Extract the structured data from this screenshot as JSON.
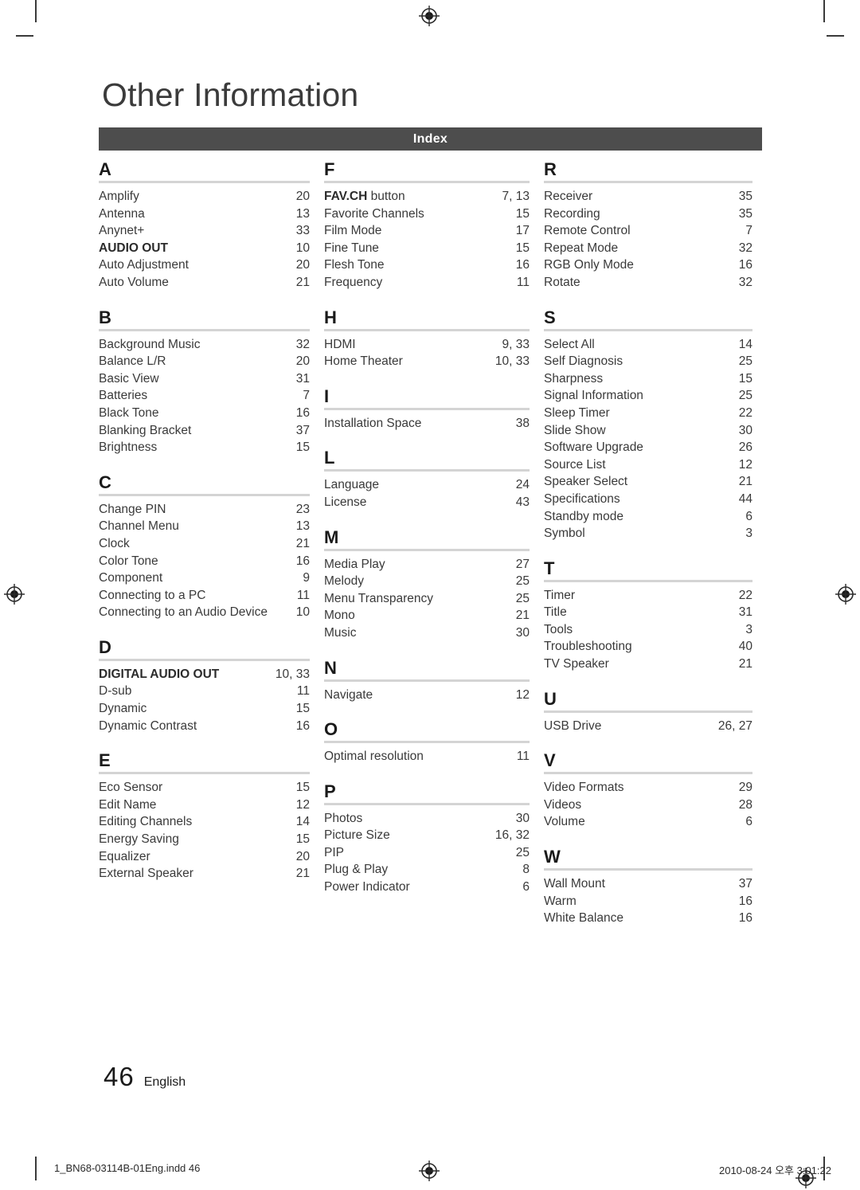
{
  "page": {
    "chapter_title": "Other Information",
    "index_bar_label": "Index",
    "folio_number": "46",
    "folio_language": "English",
    "accent_bar_color": "#4d4d4d",
    "rule_color": "#d4d4d4"
  },
  "print_footer": {
    "file_name": "1_BN68-03114B-01Eng.indd   46",
    "timestamp": "2010-08-24   오후 3:01:22"
  },
  "columns": [
    {
      "groups": [
        {
          "letter": "A",
          "entries": [
            {
              "term": "Amplify",
              "page": "20"
            },
            {
              "term": "Antenna",
              "page": "13"
            },
            {
              "term": "Anynet+",
              "page": "33"
            },
            {
              "term": "AUDIO OUT",
              "page": "10",
              "bold": true
            },
            {
              "term": "Auto Adjustment",
              "page": "20"
            },
            {
              "term": "Auto Volume",
              "page": "21"
            }
          ]
        },
        {
          "letter": "B",
          "entries": [
            {
              "term": "Background Music",
              "page": "32"
            },
            {
              "term": "Balance L/R",
              "page": "20"
            },
            {
              "term": "Basic View",
              "page": "31"
            },
            {
              "term": "Batteries",
              "page": "7"
            },
            {
              "term": "Black Tone",
              "page": "16"
            },
            {
              "term": "Blanking Bracket",
              "page": "37"
            },
            {
              "term": "Brightness",
              "page": "15"
            }
          ]
        },
        {
          "letter": "C",
          "entries": [
            {
              "term": "Change PIN",
              "page": "23"
            },
            {
              "term": "Channel Menu",
              "page": "13"
            },
            {
              "term": "Clock",
              "page": "21"
            },
            {
              "term": "Color Tone",
              "page": "16"
            },
            {
              "term": "Component",
              "page": "9"
            },
            {
              "term": "Connecting to a PC",
              "page": "11"
            },
            {
              "term": "Connecting to an Audio Device",
              "page": "10"
            }
          ]
        },
        {
          "letter": "D",
          "entries": [
            {
              "term": "DIGITAL AUDIO OUT",
              "page": "10, 33",
              "bold": true
            },
            {
              "term": "D-sub",
              "page": "11"
            },
            {
              "term": "Dynamic",
              "page": "15"
            },
            {
              "term": "Dynamic Contrast",
              "page": "16"
            }
          ]
        },
        {
          "letter": "E",
          "entries": [
            {
              "term": "Eco Sensor",
              "page": "15"
            },
            {
              "term": "Edit Name",
              "page": "12"
            },
            {
              "term": "Editing Channels",
              "page": "14"
            },
            {
              "term": "Energy Saving",
              "page": "15"
            },
            {
              "term": "Equalizer",
              "page": "20"
            },
            {
              "term": "External Speaker",
              "page": "21"
            }
          ]
        }
      ]
    },
    {
      "groups": [
        {
          "letter": "F",
          "entries": [
            {
              "term": "FAV.CH button",
              "page": "7, 13",
              "strong_prefix": "FAV.CH",
              "rest": " button"
            },
            {
              "term": "Favorite Channels",
              "page": "15"
            },
            {
              "term": "Film Mode",
              "page": "17"
            },
            {
              "term": "Fine Tune",
              "page": "15"
            },
            {
              "term": "Flesh Tone",
              "page": "16"
            },
            {
              "term": "Frequency",
              "page": "11"
            }
          ]
        },
        {
          "letter": "H",
          "entries": [
            {
              "term": "HDMI",
              "page": "9, 33"
            },
            {
              "term": "Home Theater",
              "page": "10, 33"
            }
          ]
        },
        {
          "letter": "I",
          "entries": [
            {
              "term": "Installation Space",
              "page": "38"
            }
          ]
        },
        {
          "letter": "L",
          "entries": [
            {
              "term": "Language",
              "page": "24"
            },
            {
              "term": "License",
              "page": "43"
            }
          ]
        },
        {
          "letter": "M",
          "entries": [
            {
              "term": "Media Play",
              "page": "27"
            },
            {
              "term": "Melody",
              "page": "25"
            },
            {
              "term": "Menu Transparency",
              "page": "25"
            },
            {
              "term": "Mono",
              "page": "21"
            },
            {
              "term": "Music",
              "page": "30"
            }
          ]
        },
        {
          "letter": "N",
          "entries": [
            {
              "term": "Navigate",
              "page": "12"
            }
          ]
        },
        {
          "letter": "O",
          "entries": [
            {
              "term": "Optimal resolution",
              "page": "11"
            }
          ]
        },
        {
          "letter": "P",
          "entries": [
            {
              "term": "Photos",
              "page": "30"
            },
            {
              "term": "Picture Size",
              "page": "16, 32"
            },
            {
              "term": "PIP",
              "page": "25"
            },
            {
              "term": "Plug & Play",
              "page": "8"
            },
            {
              "term": "Power Indicator",
              "page": "6"
            }
          ]
        }
      ]
    },
    {
      "groups": [
        {
          "letter": "R",
          "entries": [
            {
              "term": "Receiver",
              "page": "35"
            },
            {
              "term": "Recording",
              "page": "35"
            },
            {
              "term": "Remote Control",
              "page": "7"
            },
            {
              "term": "Repeat Mode",
              "page": "32"
            },
            {
              "term": "RGB Only Mode",
              "page": "16"
            },
            {
              "term": "Rotate",
              "page": "32"
            }
          ]
        },
        {
          "letter": "S",
          "entries": [
            {
              "term": "Select All",
              "page": "14"
            },
            {
              "term": "Self Diagnosis",
              "page": "25"
            },
            {
              "term": "Sharpness",
              "page": "15"
            },
            {
              "term": "Signal Information",
              "page": "25"
            },
            {
              "term": "Sleep Timer",
              "page": "22"
            },
            {
              "term": "Slide Show",
              "page": "30"
            },
            {
              "term": "Software Upgrade",
              "page": "26"
            },
            {
              "term": "Source List",
              "page": "12"
            },
            {
              "term": "Speaker Select",
              "page": "21"
            },
            {
              "term": "Specifications",
              "page": "44"
            },
            {
              "term": "Standby mode",
              "page": "6"
            },
            {
              "term": "Symbol",
              "page": "3"
            }
          ]
        },
        {
          "letter": "T",
          "entries": [
            {
              "term": "Timer",
              "page": "22"
            },
            {
              "term": "Title",
              "page": "31"
            },
            {
              "term": "Tools",
              "page": "3"
            },
            {
              "term": "Troubleshooting",
              "page": "40"
            },
            {
              "term": "TV Speaker",
              "page": "21"
            }
          ]
        },
        {
          "letter": "U",
          "entries": [
            {
              "term": "USB Drive",
              "page": "26, 27"
            }
          ]
        },
        {
          "letter": "V",
          "entries": [
            {
              "term": "Video Formats",
              "page": "29"
            },
            {
              "term": "Videos",
              "page": "28"
            },
            {
              "term": "Volume",
              "page": "6"
            }
          ]
        },
        {
          "letter": "W",
          "entries": [
            {
              "term": "Wall Mount",
              "page": "37"
            },
            {
              "term": "Warm",
              "page": "16"
            },
            {
              "term": "White Balance",
              "page": "16"
            }
          ]
        }
      ]
    }
  ]
}
